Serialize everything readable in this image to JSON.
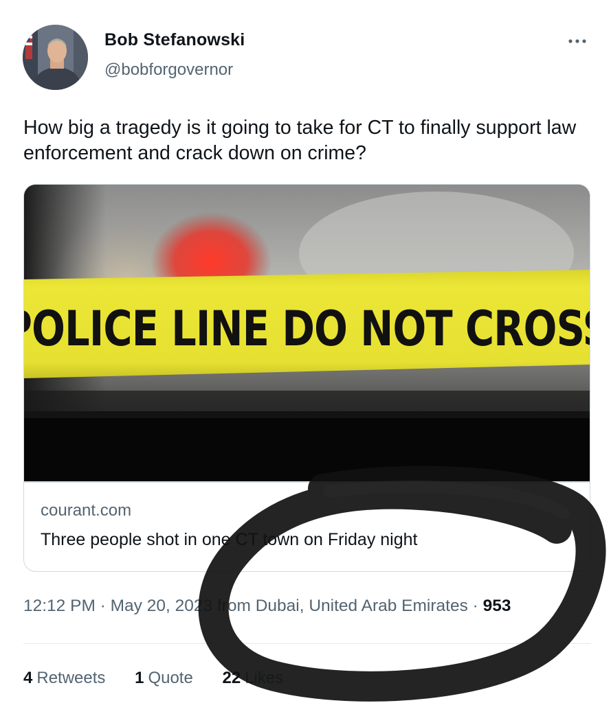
{
  "author": {
    "display_name": "Bob Stefanowski",
    "handle": "@bobforgovernor",
    "avatar_icon": "profile-photo"
  },
  "more_icon": "more-dots-icon",
  "tweet": {
    "text": "How big a tragedy is it going to take for CT to finally support law enforcement and crack down on crime?"
  },
  "card": {
    "image_caption": "POLICE LINE DO NOT CROSS",
    "domain": "courant.com",
    "title": "Three people shot in one CT town on Friday night"
  },
  "meta": {
    "timestamp": "12:12 PM · May 20, 2023 from Dubai, United Arab Emirates · ",
    "views": "953"
  },
  "stats": {
    "retweets_count": "4",
    "retweets_label": "Retweets",
    "quotes_count": "1",
    "quotes_label": "Quote",
    "likes_count": "22",
    "likes_label": "Likes"
  },
  "colors": {
    "text_primary": "#0f1419",
    "text_secondary": "#536471",
    "border": "#cfd9de",
    "tape_yellow": "#e8e22a"
  }
}
